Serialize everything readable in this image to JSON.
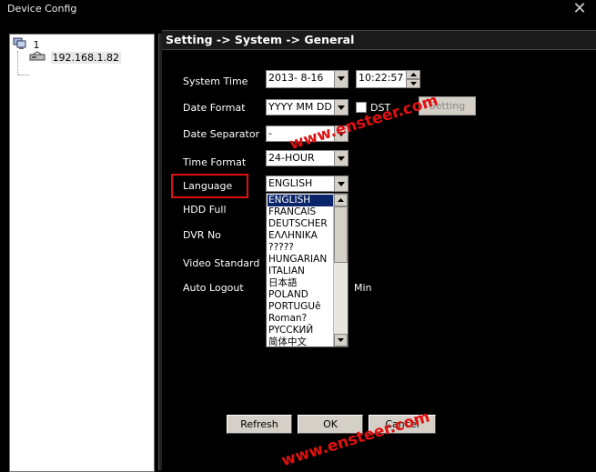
{
  "window": {
    "title": "Device Config"
  },
  "tree": {
    "root_label": "1",
    "device_label": "192.168.1.82"
  },
  "header": {
    "breadcrumb": "Setting -> System -> General"
  },
  "form": {
    "system_time": {
      "label": "System Time",
      "date": "2013-  8-16",
      "time": "10:22:57"
    },
    "date_format": {
      "label": "Date Format",
      "value": "YYYY MM DD",
      "dst_label": "DST",
      "dst_checked": false,
      "setting_label": "Setting"
    },
    "date_separator": {
      "label": "Date Separator",
      "value": "-"
    },
    "time_format": {
      "label": "Time Format",
      "value": "24-HOUR"
    },
    "language": {
      "label": "Language",
      "value": "ENGLISH",
      "options": [
        "ENGLISH",
        "FRANCAIS",
        "DEUTSCHER",
        "ΕΛΛΗΝΙΚΑ",
        "?????",
        "HUNGARIAN",
        "ITALIAN",
        "日本語",
        "POLAND",
        "PORTUGUê",
        "Roman?",
        "PYCCKИЙ",
        "简体中文"
      ],
      "selected_index": 0
    },
    "hdd_full": {
      "label": "HDD Full"
    },
    "dvr_no": {
      "label": "DVR No"
    },
    "video_standard": {
      "label": "Video Standard"
    },
    "auto_logout": {
      "label": "Auto Logout",
      "unit": "Min"
    }
  },
  "buttons": {
    "refresh": "Refresh",
    "ok": "OK",
    "cancel": "Cancel"
  },
  "watermarks": [
    "www.ensteer.com",
    "www.ensteer.com"
  ],
  "colors": {
    "highlight": "#e01010",
    "selection": "#0a246a",
    "watermark": "#e01010"
  }
}
